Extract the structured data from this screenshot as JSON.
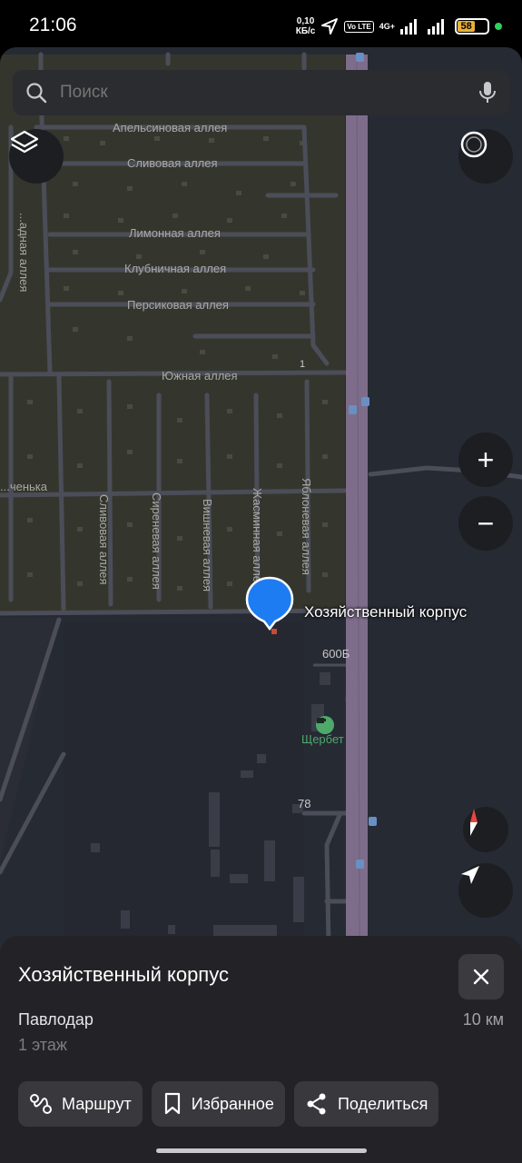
{
  "status_bar": {
    "time": "21:06",
    "speed_value": "0,10",
    "speed_unit": "КБ/с",
    "volte": "Vo LTE",
    "network": "4G+",
    "battery": "58"
  },
  "search": {
    "placeholder": "Поиск",
    "icon": "search-icon",
    "mic_icon": "mic-icon"
  },
  "map": {
    "streets": [
      "Апельсиновая аллея",
      "Сливовая аллея",
      "Лимонная аллея",
      "Клубничная аллея",
      "Персиковая аллея",
      "Южная аллея",
      "Сливовая аллея",
      "Сиреневая аллея",
      "Вишневая аллея",
      "Жасминная аллея",
      "Яблоневая аллея",
      "...адная аллея",
      "...ченька"
    ],
    "numbers": [
      "1",
      "600Б",
      "78"
    ],
    "poi_name": "Щербет",
    "pin_label": "Хозяйственный корпус",
    "controls": {
      "layers": "layers-icon",
      "profile": "profile-ring-icon",
      "zoom_in": "+",
      "zoom_out": "−",
      "compass": "compass-icon",
      "locate": "locate-arrow-icon"
    }
  },
  "place_card": {
    "title": "Хозяйственный корпус",
    "city": "Павлодар",
    "distance": "10 км",
    "floor": "1 этаж",
    "actions": {
      "route": "Маршрут",
      "favorite": "Избранное",
      "share": "Поделиться"
    }
  }
}
